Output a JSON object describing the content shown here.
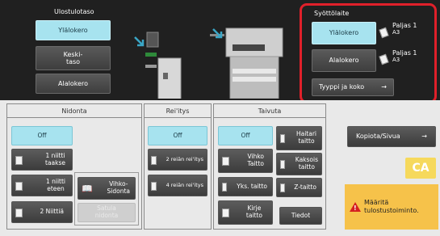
{
  "output_tray": {
    "label": "Ulostulotaso",
    "options": [
      "Ylälokero",
      "Keski-\ntaso",
      "Alalokero"
    ],
    "selected_index": 0
  },
  "paper_source": {
    "label": "Syöttölaite",
    "trays": [
      {
        "label": "Ylälokero",
        "paper_type": "Paljas 1",
        "paper_size": "A3",
        "selected": true
      },
      {
        "label": "Alalokero",
        "paper_type": "Paljas 1",
        "paper_size": "A3",
        "selected": false
      }
    ],
    "type_size_button": "Tyyppi ja koko"
  },
  "stapling": {
    "title": "Nidonta",
    "off": "Off",
    "one_back": "1 niitti\ntaakse",
    "one_front": "1 niitti\neteen",
    "two": "2 Niittiä",
    "saddle": "Vihko-\nSidonta",
    "disabled": "Satula\nnidonta"
  },
  "punch": {
    "title": "Rei'itys",
    "off": "Off",
    "two_hole": "2 reiän rei'itys",
    "four_hole": "4 reiän rei'itys"
  },
  "fold": {
    "title": "Taivuta",
    "off": "Off",
    "booklet": "Vihko\nTaitto",
    "single": "Yks. taitto",
    "letter": "Kirje\ntaitto",
    "accordion": "Haitari\ntaitto",
    "double": "Kaksois\ntaitto",
    "z_fold": "Z-taitto",
    "info": "Tiedot"
  },
  "copy_per_page": "Kopiota/Sivua",
  "ca_label": "CA",
  "warning": "Määritä\ntulostustoiminto.",
  "colors": {
    "selected": "#a7e3ef",
    "warning": "#f6c24a",
    "highlight": "#e0202a",
    "ca": "#f6d95c"
  }
}
